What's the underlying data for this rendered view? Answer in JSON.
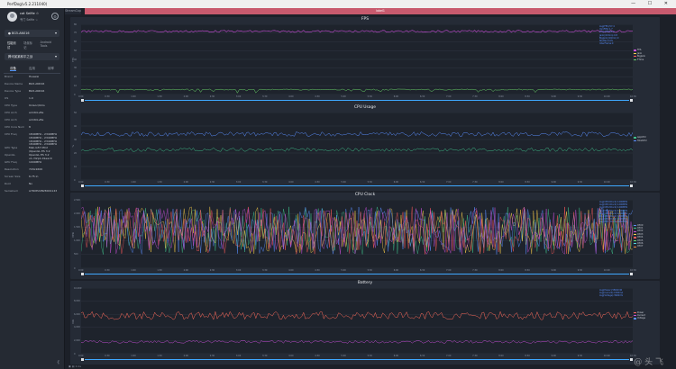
{
  "window": {
    "title": "PerfDog(v5.2.211040)"
  },
  "user": {
    "name": "cat Selfie ☆",
    "sub": "专门 Selfie ☆"
  },
  "device": {
    "name": "● BG5-AN016"
  },
  "top_tabs": [
    "性能测试",
    "场景标记",
    "Android Tools"
  ],
  "app": {
    "name": "腾讯某某和平之战"
  },
  "info_tabs": [
    {
      "label": "设备",
      "active": true
    },
    {
      "label": "应用",
      "active": false
    },
    {
      "label": "帧率",
      "active": false
    }
  ],
  "info_rows": [
    {
      "k": "Brand",
      "v": "Huawei"
    },
    {
      "k": "Device Name",
      "v": "BG5-AN016"
    },
    {
      "k": "Device Type",
      "v": "BG5-AN016"
    },
    {
      "k": "OS",
      "v": "1.0"
    },
    {
      "k": "CPU Type",
      "v": "Unisoc/Ums"
    },
    {
      "k": "CPU Arch",
      "v": "arm64-v8a"
    },
    {
      "k": "CPU Arch",
      "v": "arm64-v8a"
    },
    {
      "k": "CPU Core Num",
      "v": "8"
    },
    {
      "k": "CPU Freq",
      "v": "1840MHz - 2340MHz\n1840MHz - 2340MHz\n1840MHz - 2340MHz\n1840MHz - 2340MHz"
    },
    {
      "k": "GPU Type",
      "v": "Mali-G57 MC2\n/OpenGL ES 3.2"
    },
    {
      "k": "OpenGL",
      "v": "OpenGL ES 3.2 v1.r32p1-01eac0"
    },
    {
      "k": "GPU Freq",
      "v": "1000MHz"
    },
    {
      "k": "Resolution",
      "v": "720x1600"
    },
    {
      "k": "Screen Size",
      "v": "6.75 in"
    },
    {
      "k": "Root",
      "v": "No"
    },
    {
      "k": "Serialnum",
      "v": "A7RXE22B28001143"
    }
  ],
  "strip": {
    "left": "StreamCap",
    "label": "label1"
  },
  "panels": [
    {
      "title": "FPS",
      "ylabel": "FPS",
      "yticks": [
        "80",
        "70",
        "60",
        "50",
        "40",
        "30",
        "20",
        "10",
        "0"
      ],
      "xticks": [
        "0:00",
        "0:30",
        "1:00",
        "1:30",
        "2:00",
        "2:30",
        "3:00",
        "3:30",
        "4:00",
        "4:30",
        "5:00",
        "5:30",
        "6:00",
        "6:30",
        "7:00",
        "7:30",
        "8:00",
        "8:30",
        "9:00",
        "9:30",
        "10:00",
        "10:30"
      ],
      "stats": [
        "Avg(FPS):57.4",
        "Var(FPS):1.7",
        "Drop(FPS)/h:0",
        "Jank(/10min):0.8",
        "BigJank(/10min):0",
        "Stutter:0.0%",
        "InterFrame:0"
      ],
      "legend": [
        {
          "name": "FPS",
          "color": "#c84fd8"
        },
        {
          "name": "Jank",
          "color": "#ffd24a"
        },
        {
          "name": "BigJank",
          "color": "#ff5a5a"
        },
        {
          "name": "FTime",
          "color": "#6bd66b"
        }
      ]
    },
    {
      "title": "CPU Usage",
      "ylabel": "%",
      "yticks": [
        "50",
        "40",
        "30",
        "20",
        "10",
        "0"
      ],
      "xticks": [
        "0:00",
        "0:30",
        "1:00",
        "1:30",
        "2:00",
        "2:30",
        "3:00",
        "3:30",
        "4:00",
        "4:30",
        "5:00",
        "5:30",
        "6:00",
        "6:30",
        "7:00",
        "7:30",
        "8:00",
        "8:30",
        "9:00",
        "9:30",
        "10:00",
        "10:30"
      ],
      "stats": [],
      "legend": [
        {
          "name": "AppCPU",
          "color": "#3fbf8a"
        },
        {
          "name": "TotalCPU",
          "color": "#5a8fff"
        }
      ]
    },
    {
      "title": "CPU Clock",
      "ylabel": "MHz",
      "yticks": [
        "2,500",
        "2,000",
        "1,500",
        "1,000",
        "500",
        "0"
      ],
      "xticks": [
        "0:00",
        "0:30",
        "1:00",
        "1:30",
        "2:00",
        "2:30",
        "3:00",
        "3:30",
        "4:00",
        "4:30",
        "5:00",
        "5:30",
        "6:00",
        "6:30",
        "7:00",
        "7:30",
        "8:00",
        "8:30",
        "9:00",
        "9:30",
        "10:00",
        "10:30"
      ],
      "stats": [
        "Avg(CPU0Clock):1200MHz",
        "Avg(CPU1Clock):1200MHz",
        "Avg(CPU2Clock):1200MHz",
        "Avg(CPU3Clock):1200MHz",
        "Avg(CPU4Clock):1600MHz",
        "Avg(CPU5Clock):1600MHz",
        "Avg(CPU6Clock):1600MHz",
        "Avg(CPU7Clock):1600MHz"
      ],
      "legend": [
        {
          "name": "CPU0",
          "color": "#5a8fff"
        },
        {
          "name": "CPU1",
          "color": "#3fbf8a"
        },
        {
          "name": "CPU2",
          "color": "#c84fd8"
        },
        {
          "name": "CPU3",
          "color": "#ffd24a"
        },
        {
          "name": "CPU4",
          "color": "#ff5a5a"
        },
        {
          "name": "CPU5",
          "color": "#6bd66b"
        },
        {
          "name": "CPU6",
          "color": "#4fd6e0"
        },
        {
          "name": "CPU7",
          "color": "#f08a3c"
        }
      ]
    },
    {
      "title": "Battery",
      "ylabel": "mW",
      "yticks": [
        "10,000",
        "8,000",
        "6,000",
        "4,000",
        "2,000",
        "0"
      ],
      "xticks": [
        "0:00",
        "0:30",
        "1:00",
        "1:30",
        "2:00",
        "2:30",
        "3:00",
        "3:30",
        "4:00",
        "4:30",
        "5:00",
        "5:30",
        "6:00",
        "6:30",
        "7:00",
        "7:30",
        "8:00",
        "8:30",
        "9:00",
        "9:30",
        "10:00",
        "10:30"
      ],
      "stats": [
        "Avg(Power):5800mW",
        "Avg(Current):1500mA",
        "Avg(Voltage):3900mV"
      ],
      "legend": [
        {
          "name": "Power",
          "color": "#ff6a5a"
        },
        {
          "name": "Current",
          "color": "#c84fd8"
        },
        {
          "name": "Voltage",
          "color": "#5a8fff"
        }
      ]
    }
  ],
  "bottom": {
    "text": "▣ ▤ 0.1s"
  },
  "watermark": {
    "text": "@ 头 飞"
  },
  "chart_data": [
    {
      "type": "line",
      "title": "FPS",
      "ylabel": "FPS",
      "ylim": [
        0,
        80
      ],
      "x": "0:00 → 10:30",
      "series": [
        {
          "name": "FPS",
          "values": [
            60,
            59,
            60,
            58,
            60,
            60,
            57,
            60,
            59,
            60,
            58,
            60
          ]
        },
        {
          "name": "FTime",
          "values": [
            17,
            17,
            18,
            17,
            17,
            19,
            17,
            17,
            18,
            17,
            17,
            17
          ]
        }
      ]
    },
    {
      "type": "line",
      "title": "CPU Usage",
      "ylabel": "%",
      "ylim": [
        0,
        50
      ],
      "x": "0:00 → 10:30",
      "series": [
        {
          "name": "TotalCPU",
          "values": [
            33,
            34,
            33,
            32,
            33,
            34,
            33,
            34,
            35,
            38,
            36,
            33
          ]
        },
        {
          "name": "AppCPU",
          "values": [
            22,
            21,
            22,
            21,
            22,
            22,
            23,
            22,
            22,
            25,
            24,
            22
          ]
        }
      ]
    },
    {
      "type": "line",
      "title": "CPU Clock",
      "ylabel": "MHz",
      "ylim": [
        0,
        2500
      ],
      "x": "0:00 → 10:30",
      "series": [
        {
          "name": "CPU0",
          "values": [
            1200,
            1400,
            1000,
            1600,
            1200,
            900,
            1500,
            1200,
            1100,
            1600,
            1300,
            1200
          ]
        },
        {
          "name": "CPU4",
          "values": [
            1600,
            2200,
            1400,
            2000,
            1700,
            1200,
            2100,
            1500,
            1800,
            2300,
            1400,
            1700
          ]
        }
      ]
    },
    {
      "type": "line",
      "title": "Battery",
      "ylabel": "mW",
      "ylim": [
        0,
        10000
      ],
      "x": "0:00 → 10:30",
      "series": [
        {
          "name": "Power",
          "values": [
            6000,
            5800,
            6100,
            5900,
            5700,
            6000,
            5900,
            5800,
            6100,
            5900,
            6000,
            5800
          ]
        },
        {
          "name": "Current",
          "values": [
            1500,
            1500,
            1400,
            1500,
            1500,
            1500,
            1400,
            1500,
            1500,
            1500,
            1500,
            1500
          ]
        }
      ]
    }
  ]
}
